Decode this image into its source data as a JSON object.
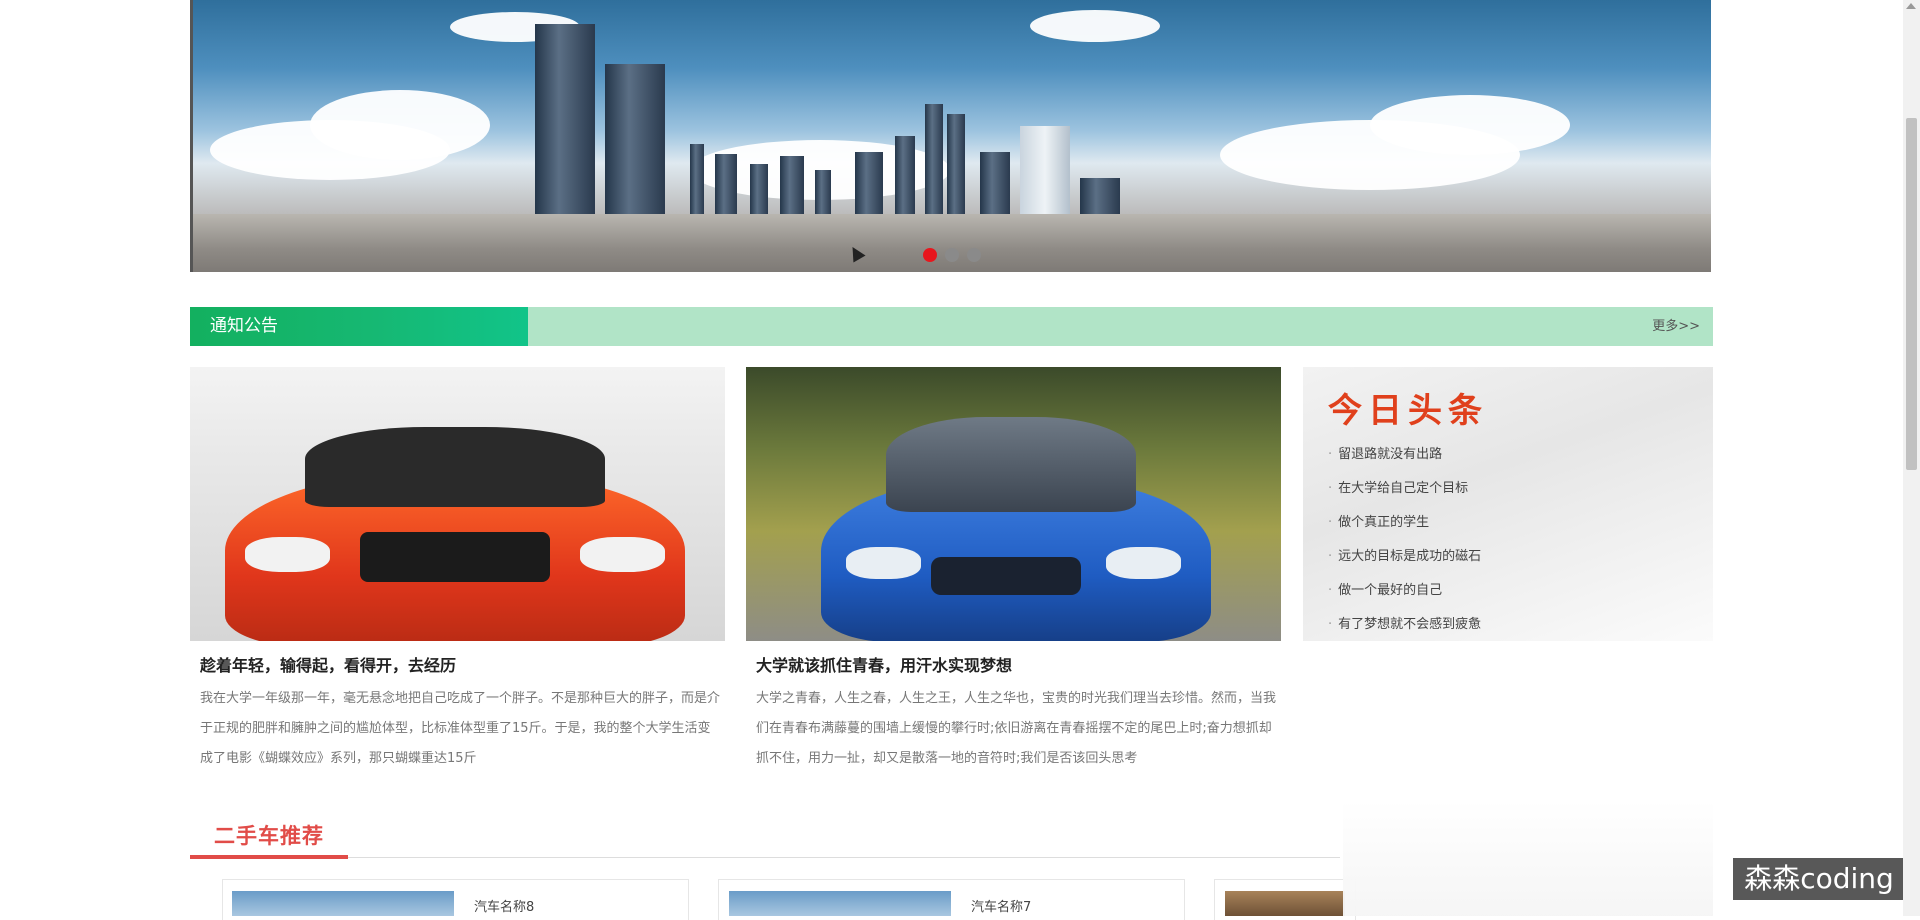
{
  "banner": {
    "slides": 3,
    "active_slide": 1
  },
  "notice": {
    "title": "通知公告",
    "more": "更多>>"
  },
  "news": [
    {
      "title": "趁着年轻，输得起，看得开，去经历",
      "desc": "我在大学一年级那一年，毫无悬念地把自己吃成了一个胖子。不是那种巨大的胖子，而是介于正规的肥胖和臃肿之间的尴尬体型，比标准体型重了15斤。于是，我的整个大学生活变成了电影《蝴蝶效应》系列，那只蝴蝶重达15斤",
      "image": "red-car"
    },
    {
      "title": "大学就该抓住青春，用汗水实现梦想",
      "desc": "大学之青春，人生之春，人生之王，人生之华也，宝贵的时光我们理当去珍惜。然而，当我们在青春布满藤蔓的围墙上缓慢的攀行时;依旧游离在青春摇摆不定的尾巴上时;奋力想抓却抓不住，用力一扯，却又是散落一地的音符时;我们是否该回头思考",
      "image": "blue-car"
    }
  ],
  "headlines": {
    "logo_text": "今日头条",
    "items": [
      "留退路就没有出路",
      "在大学给自己定个目标",
      "做个真正的学生",
      "远大的目标是成功的磁石",
      "做一个最好的自己",
      "有了梦想就不会感到疲惫"
    ]
  },
  "used_cars": {
    "title": "二手车推荐",
    "items": [
      {
        "name": "汽车名称8"
      },
      {
        "name": "汽车名称7"
      }
    ]
  },
  "watermark": "森森coding",
  "colors": {
    "notice_green": "#16b873",
    "notice_bar": "#b1e4c7",
    "accent_red": "#e14c48",
    "dot_active": "#e8161d"
  }
}
